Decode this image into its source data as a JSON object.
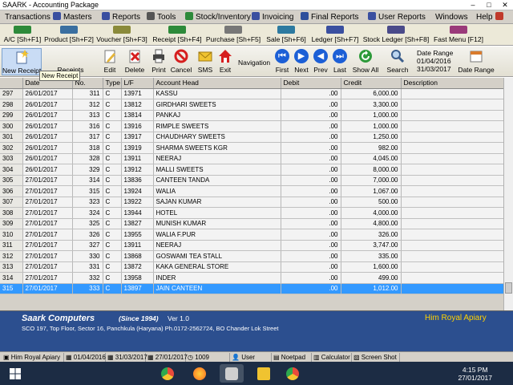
{
  "window": {
    "title": "SAARK - Accounting Package",
    "min": "–",
    "max": "□",
    "close": "✕"
  },
  "menu": [
    {
      "label": "Transactions",
      "color": ""
    },
    {
      "label": "Masters",
      "color": "#3a4fa0"
    },
    {
      "label": "Reports",
      "color": "#3a4fa0"
    },
    {
      "label": "Tools",
      "color": "#555555"
    },
    {
      "label": "Stock/Inventory",
      "color": "#2d8a3a"
    },
    {
      "label": "Invoicing",
      "color": "#3a4fa0"
    },
    {
      "label": "Final Reports",
      "color": "#2d4f9c"
    },
    {
      "label": "User Reports",
      "color": "#3a4fa0"
    },
    {
      "label": "Windows",
      "color": ""
    },
    {
      "label": "Help",
      "color": "#c0392b"
    }
  ],
  "shortcuts": [
    {
      "label": "A/C [Sh+F1]",
      "color": "#2d8a3a"
    },
    {
      "label": "Product [Sh+F2]",
      "color": "#3a6fa0"
    },
    {
      "label": "Voucher [Sh+F3]",
      "color": "#8a8a3a"
    },
    {
      "label": "Receipt [Sh+F4]",
      "color": "#2d8a3a"
    },
    {
      "label": "Purchase [Sh+F5]",
      "color": "#777777"
    },
    {
      "label": "Sale [Sh+F6]",
      "color": "#2d7aa0"
    },
    {
      "label": "Ledger [Sh+F7]",
      "color": "#3a4fa0"
    },
    {
      "label": "Stock Ledger [Sh+F8]",
      "color": "#4a4a8a"
    },
    {
      "label": "Fast Menu [F12]",
      "color": "#9a3a7a"
    }
  ],
  "toolbar": {
    "new_receipt": "New Receipt",
    "receipts": "Receipts",
    "edit": "Edit",
    "delete": "Delete",
    "print": "Print",
    "cancel": "Cancel",
    "sms": "SMS",
    "exit": "Exit",
    "navigation": "Navigation",
    "first": "First",
    "next": "Next",
    "prev": "Prev",
    "last": "Last",
    "show_all": "Show All",
    "search": "Search",
    "date_range_title": "Date Range",
    "date_from": "01/04/2016",
    "date_to": "31/03/2017",
    "date_range_button": "Date Range",
    "tooltip": "New Receipt"
  },
  "table": {
    "columns": [
      "",
      "Date",
      "No.",
      "Type",
      "L/F",
      "Account Head",
      "Debit",
      "Credit",
      "Description"
    ],
    "rows": [
      [
        "297",
        "26/01/2017",
        "311",
        "C",
        "13971",
        "KASSU",
        ".00",
        "6,000.00",
        ""
      ],
      [
        "298",
        "26/01/2017",
        "312",
        "C",
        "13812",
        "GIRDHARI SWEETS",
        ".00",
        "3,300.00",
        ""
      ],
      [
        "299",
        "26/01/2017",
        "313",
        "C",
        "13814",
        "PANKAJ",
        ".00",
        "1,000.00",
        ""
      ],
      [
        "300",
        "26/01/2017",
        "316",
        "C",
        "13916",
        "RIMPLE SWEETS",
        ".00",
        "1,000.00",
        ""
      ],
      [
        "301",
        "26/01/2017",
        "317",
        "C",
        "13917",
        "CHAUDHARY SWEETS",
        ".00",
        "1,250.00",
        ""
      ],
      [
        "302",
        "26/01/2017",
        "318",
        "C",
        "13919",
        "SHARMA SWEETS KGR",
        ".00",
        "982.00",
        ""
      ],
      [
        "303",
        "26/01/2017",
        "328",
        "C",
        "13911",
        "NEERAJ",
        ".00",
        "4,045.00",
        ""
      ],
      [
        "304",
        "26/01/2017",
        "329",
        "C",
        "13912",
        "MALLI SWEETS",
        ".00",
        "8,000.00",
        ""
      ],
      [
        "305",
        "27/01/2017",
        "314",
        "C",
        "13836",
        "CANTEEN TANDA",
        ".00",
        "7,000.00",
        ""
      ],
      [
        "306",
        "27/01/2017",
        "315",
        "C",
        "13924",
        "WALIA",
        ".00",
        "1,067.00",
        ""
      ],
      [
        "307",
        "27/01/2017",
        "323",
        "C",
        "13922",
        "SAJAN KUMAR",
        ".00",
        "500.00",
        ""
      ],
      [
        "308",
        "27/01/2017",
        "324",
        "C",
        "13944",
        "HOTEL",
        ".00",
        "4,000.00",
        ""
      ],
      [
        "309",
        "27/01/2017",
        "325",
        "C",
        "13827",
        "MUNISH KUMAR",
        ".00",
        "4,800.00",
        ""
      ],
      [
        "310",
        "27/01/2017",
        "326",
        "C",
        "13955",
        "WALIA F.PUR",
        ".00",
        "326.00",
        ""
      ],
      [
        "311",
        "27/01/2017",
        "327",
        "C",
        "13911",
        "NEERAJ",
        ".00",
        "3,747.00",
        ""
      ],
      [
        "312",
        "27/01/2017",
        "330",
        "C",
        "13868",
        "GOSWAMI TEA STALL",
        ".00",
        "335.00",
        ""
      ],
      [
        "313",
        "27/01/2017",
        "331",
        "C",
        "13872",
        "KAKA GENERAL STORE",
        ".00",
        "1,600.00",
        ""
      ],
      [
        "314",
        "27/01/2017",
        "332",
        "C",
        "13958",
        "INDER",
        ".00",
        "499.00",
        ""
      ],
      [
        "315",
        "27/01/2017",
        "333",
        "C",
        "13897",
        "JAIN CANTEEN",
        ".00",
        "1,012.00",
        ""
      ]
    ]
  },
  "footer": {
    "company": "Saark Computers",
    "since": "(Since 1994)",
    "version": "Ver 1.0",
    "address": "SCO 197, Top Floor, Sector 16, Panchkula (Haryana) Ph.0172-2562724,  BO Chander Lok Street",
    "firm_name": "Him Royal Apiary"
  },
  "status": {
    "firm": "Him Royal Apiary",
    "from": "01/04/2016",
    "to": "31/03/2017",
    "today": "27/01/2017",
    "count": "1009",
    "user": "User",
    "notepad": "Noetpad",
    "calculator": "Calculator",
    "screenshot": "Screen Shot"
  },
  "taskbar": {
    "time": "4:15 PM",
    "date": "27/01/2017",
    "apps": [
      {
        "name": "windows-start-icon",
        "color": "#ffffff"
      },
      {
        "name": "chrome-icon",
        "color": "#e84b3c"
      },
      {
        "name": "firefox-icon",
        "color": "#ff8a1e"
      },
      {
        "name": "app-icon",
        "color": "#cfcfcf"
      },
      {
        "name": "file-explorer-icon",
        "color": "#f0c330"
      },
      {
        "name": "chrome-icon",
        "color": "#e84b3c"
      }
    ]
  }
}
